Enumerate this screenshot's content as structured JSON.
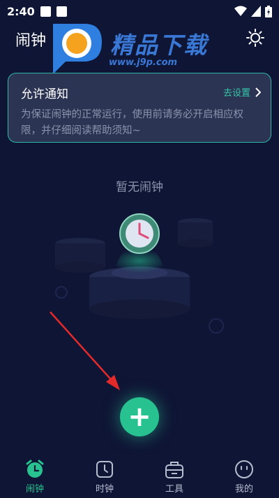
{
  "status_bar": {
    "time": "2:40"
  },
  "header": {
    "title": "闹钟"
  },
  "watermark": {
    "text": "精品下载",
    "url": "www.j9p.com"
  },
  "notice": {
    "title": "允许通知",
    "action": "去设置",
    "body": "为保证闹钟的正常运行，使用前请务必开启相应权限，并仔细阅读帮助须知~"
  },
  "empty_state": {
    "text": "暂无闹钟"
  },
  "add_button": {
    "label": "+"
  },
  "bottom_nav": {
    "items": [
      {
        "label": "闹钟",
        "icon": "alarm-clock-icon",
        "active": true
      },
      {
        "label": "时钟",
        "icon": "clock-icon",
        "active": false
      },
      {
        "label": "工具",
        "icon": "toolbox-icon",
        "active": false
      },
      {
        "label": "我的",
        "icon": "smiley-icon",
        "active": false
      }
    ]
  },
  "colors": {
    "background": "#0f1535",
    "accent": "#27c28f",
    "card_border": "#2fb6a6",
    "arrow": "#e32a2a"
  }
}
